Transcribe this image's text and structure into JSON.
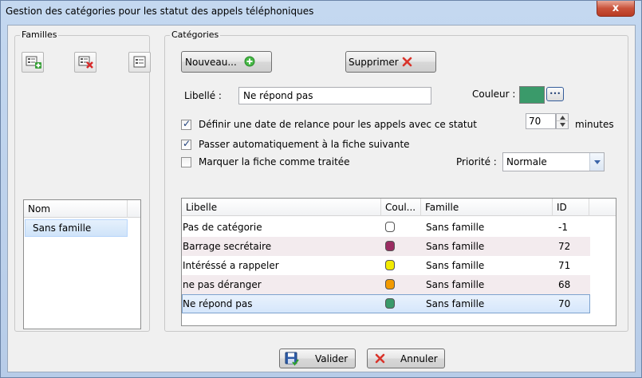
{
  "window": {
    "title": "Gestion des catégories pour les statut des appels téléphoniques",
    "close_glyph": "x"
  },
  "familles": {
    "group_label": "Familles",
    "list_header": "Nom",
    "items": [
      "Sans famille"
    ]
  },
  "categories": {
    "group_label": "Catégories",
    "new_button": "Nouveau...",
    "delete_button": "Supprimer",
    "libelle_label": "Libellé :",
    "libelle_value": "Ne répond pas",
    "couleur_label": "Couleur :",
    "couleur_value": "#3a9a6a",
    "couleur_dots": "•••",
    "relance_label": "Définir une date de relance pour les appels avec ce statut",
    "relance_checked": true,
    "minutes_value": "70",
    "minutes_label": "minutes",
    "suivante_label": "Passer automatiquement à la fiche suivante",
    "suivante_checked": true,
    "traitee_label": "Marquer la fiche comme traitée",
    "traitee_checked": false,
    "priorite_label": "Priorité :",
    "priorite_value": "Normale"
  },
  "table": {
    "headers": [
      "Libelle",
      "Coul...",
      "Famille",
      "ID"
    ],
    "rows": [
      {
        "libelle": "Pas de catégorie",
        "color": "#ffffff",
        "famille": "Sans famille",
        "id": "-1"
      },
      {
        "libelle": "Barrage secrétaire",
        "color": "#9b2c62",
        "famille": "Sans famille",
        "id": "72"
      },
      {
        "libelle": "Intéréssé a rappeler",
        "color": "#f2ea00",
        "famille": "Sans famille",
        "id": "71"
      },
      {
        "libelle": "ne pas déranger",
        "color": "#f29a00",
        "famille": "Sans famille",
        "id": "68"
      },
      {
        "libelle": "Ne répond pas",
        "color": "#3a9a6a",
        "famille": "Sans famille",
        "id": "70"
      }
    ]
  },
  "footer": {
    "ok_button": "Valider",
    "cancel_button": "Annuler"
  }
}
